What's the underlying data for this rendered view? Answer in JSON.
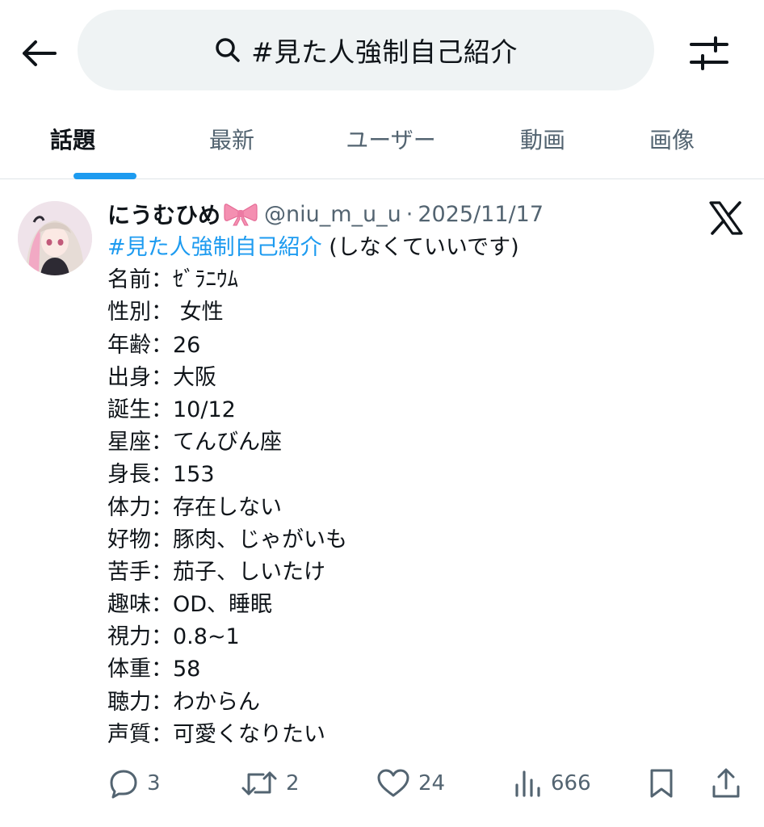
{
  "search": {
    "query": "#見た人強制自己紹介"
  },
  "tabs": [
    {
      "label": "話題",
      "active": true
    },
    {
      "label": "最新",
      "active": false
    },
    {
      "label": "ユーザー",
      "active": false
    },
    {
      "label": "動画",
      "active": false
    },
    {
      "label": "画像",
      "active": false
    }
  ],
  "post": {
    "display_name": "にうむひめ",
    "handle": "@niu_m_u_u",
    "separator": "·",
    "date": "2025/11/17",
    "hashtag": "#見た人強制自己紹介",
    "hashtag_suffix": " (しなくていいです)",
    "lines": [
      "名前：ｾﾞﾗﾆｳﾑ",
      "性別： 女性",
      "年齢：26",
      "出身：大阪",
      "誕生：10/12",
      "星座：てんびん座",
      "身長：153",
      "体力：存在しない",
      "好物：豚肉、じゃがいも",
      "苦手：茄子、しいたけ",
      "趣味：OD、睡眠",
      "視力：0.8~1",
      "体重：58",
      "聴力：わからん",
      "声質：可愛くなりたい"
    ],
    "stats": {
      "replies": "3",
      "reposts": "2",
      "likes": "24",
      "views": "666"
    }
  },
  "colors": {
    "accent": "#1d9bf0",
    "text": "#0f1419",
    "secondary": "#536471",
    "search_bg": "#eff3f4",
    "bow": "#f48fb1"
  },
  "icons": {
    "back": "arrow-left-icon",
    "search": "search-icon",
    "filter": "sliders-icon",
    "source": "x-logo-icon",
    "bow": "ribbon-bow-icon",
    "reply": "reply-icon",
    "repost": "repost-icon",
    "like": "heart-icon",
    "views": "views-icon",
    "bookmark": "bookmark-icon",
    "share": "share-icon"
  }
}
